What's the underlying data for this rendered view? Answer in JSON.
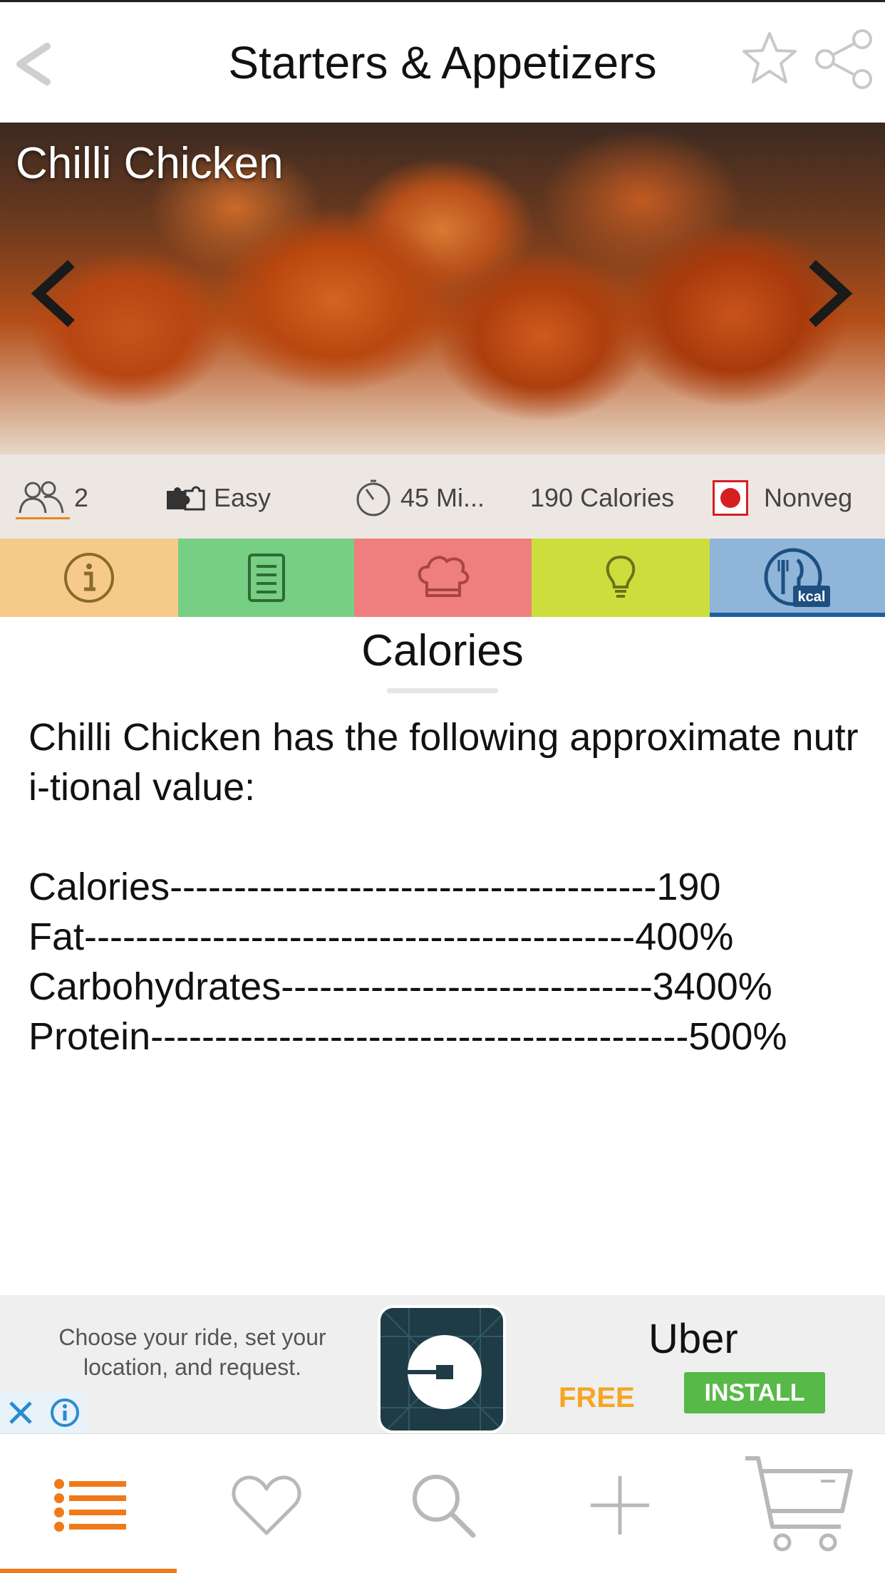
{
  "header": {
    "title": "Starters & Appetizers",
    "icons": [
      "back-chevron-icon",
      "star-icon",
      "share-icon"
    ]
  },
  "hero": {
    "title": "Chilli Chicken",
    "icons": [
      "chevron-left-icon",
      "chevron-right-icon"
    ]
  },
  "meta": {
    "serves": "2",
    "difficulty": "Easy",
    "time": "45 Mi...",
    "calories": "190 Calories",
    "diet": "Nonveg",
    "diet_color": "#d62020"
  },
  "tabs": [
    {
      "icon": "info-icon",
      "color": "#f6cb8a"
    },
    {
      "icon": "ingredients-list-icon",
      "color": "#76cf82"
    },
    {
      "icon": "chef-hat-icon",
      "color": "#ef7e7e"
    },
    {
      "icon": "lightbulb-icon",
      "color": "#ccdd3d"
    },
    {
      "icon": "kcal-icon",
      "color": "#8fb5d9",
      "active": true
    }
  ],
  "section": {
    "title": "Calories",
    "body": "Chilli Chicken has the following approximate nutri-tional value:\n\nCalories--------------------------------------190\nFat-------------------------------------------400%\nCarbohydrates-----------------------------3400%\nProtein------------------------------------------500%"
  },
  "ad": {
    "tagline": "Choose your ride, set your location, and request.",
    "name": "Uber",
    "price": "FREE",
    "cta": "INSTALL"
  },
  "bottom_nav": {
    "items": [
      "list-icon",
      "heart-icon",
      "search-icon",
      "plus-icon",
      "cart-icon"
    ],
    "accent": "#f07a1a"
  }
}
